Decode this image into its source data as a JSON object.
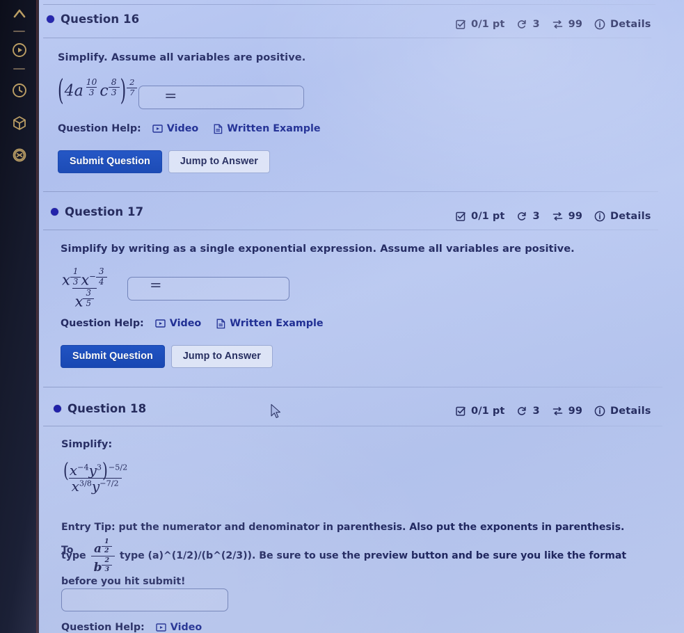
{
  "sidebar": {
    "icons": [
      {
        "name": "caret-up-icon",
        "glyph": "caret-up"
      },
      {
        "name": "divider-line",
        "glyph": "divider"
      },
      {
        "name": "play-circle-icon",
        "glyph": "play-circle"
      },
      {
        "name": "divider-line",
        "glyph": "divider"
      },
      {
        "name": "clock-icon",
        "glyph": "clock"
      },
      {
        "name": "cube-icon",
        "glyph": "cube"
      },
      {
        "name": "flower-icon",
        "glyph": "flower"
      }
    ]
  },
  "meta_common": {
    "points": "0/1 pt",
    "attempts": "3",
    "version": "99",
    "details": "Details"
  },
  "help_common": {
    "label": "Question Help:",
    "video": "Video",
    "written_example": "Written Example"
  },
  "buttons_common": {
    "submit": "Submit Question",
    "jump": "Jump to Answer"
  },
  "questions": [
    {
      "title": "Question 16",
      "prompt": "Simplify. Assume all variables are positive.",
      "expression": {
        "coefficient": "4",
        "base1": "a",
        "exp1_num": "10",
        "exp1_den": "3",
        "base2": "c",
        "exp2_num": "8",
        "exp2_den": "3",
        "outer_num": "2",
        "outer_den": "7",
        "equals": "="
      },
      "answer_value": ""
    },
    {
      "title": "Question 17",
      "prompt": "Simplify by writing as a single exponential expression. Assume all variables are positive.",
      "expression": {
        "num_base1": "x",
        "num_exp1_num": "1",
        "num_exp1_den": "3",
        "num_base2": "x",
        "num_exp2_sign": "−",
        "num_exp2_num": "3",
        "num_exp2_den": "4",
        "den_base": "x",
        "den_exp_num": "3",
        "den_exp_den": "5",
        "equals": "="
      },
      "answer_value": ""
    },
    {
      "title": "Question 18",
      "prompt": "Simplify:",
      "expression": {
        "num_base1": "x",
        "num_exp1": "−4",
        "num_base2": "y",
        "num_exp2": "3",
        "outer_exp": "−5/2",
        "den_base1": "x",
        "den_exp1": "3/8",
        "den_base2": "y",
        "den_exp2": "−7/2"
      },
      "entry_tip_line1": "Entry Tip: put the numerator and denominator in parenthesis. Also put the exponents in parenthesis. To",
      "entry_tip_line2_pre": "type",
      "entry_tip_frac_num": "a",
      "entry_tip_frac_num_exp": "1",
      "entry_tip_frac_num_exp_den": "2",
      "entry_tip_frac_den": "b",
      "entry_tip_frac_den_exp": "2",
      "entry_tip_frac_den_exp_den": "3",
      "entry_tip_line2_post": "type (a)^(1/2)/(b^(2/3)). Be sure to use the preview button and be sure you like the format",
      "entry_tip_line3": "before you hit submit!",
      "answer_value": "",
      "help_label": "Question Help:",
      "help_video": "Video"
    }
  ],
  "colors": {
    "accent_blue": "#1344b4",
    "dot_blue": "#1a1aa8",
    "text_navy": "#1f2660",
    "sidebar_bg": "#161a2c",
    "sidebar_icon": "#c8a96a",
    "page_bg": "#b5c5f1"
  }
}
